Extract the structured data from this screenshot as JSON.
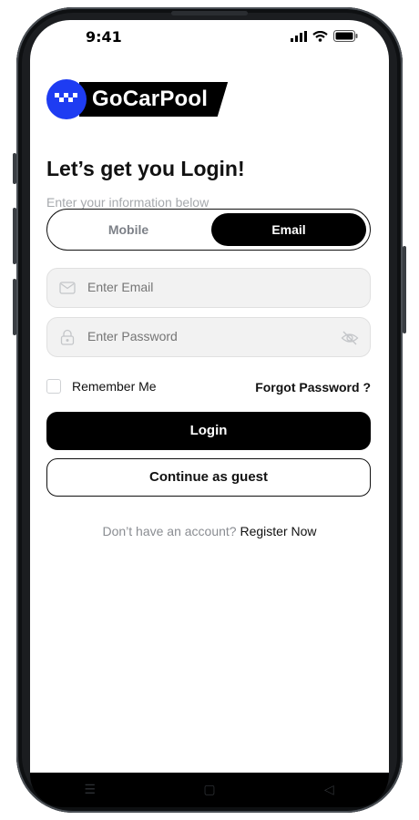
{
  "status_bar": {
    "time": "9:41"
  },
  "brand": {
    "name": "GoCarPool"
  },
  "login": {
    "title": "Let’s get you Login!",
    "subtitle": "Enter your information below",
    "tabs": [
      {
        "label": "Mobile",
        "selected": false
      },
      {
        "label": "Email",
        "selected": true
      }
    ],
    "email_placeholder": "Enter Email",
    "password_placeholder": "Enter Password",
    "remember_label": "Remember Me",
    "remember_checked": false,
    "forgot_label": "Forgot Password ?",
    "login_button": "Login",
    "guest_button": "Continue as guest",
    "register_prompt": "Don’t have an account?",
    "register_link": "Register Now"
  },
  "icons": {
    "email_field": "mail-icon",
    "password_field": "lock-icon",
    "password_toggle": "eye-off-icon",
    "nav": [
      "menu-icon",
      "home-square-icon",
      "back-triangle-icon"
    ]
  },
  "colors": {
    "accent": "#1e3cf2",
    "primary": "#000000",
    "muted_text": "#8a8d92",
    "field_bg": "#f2f2f2"
  }
}
